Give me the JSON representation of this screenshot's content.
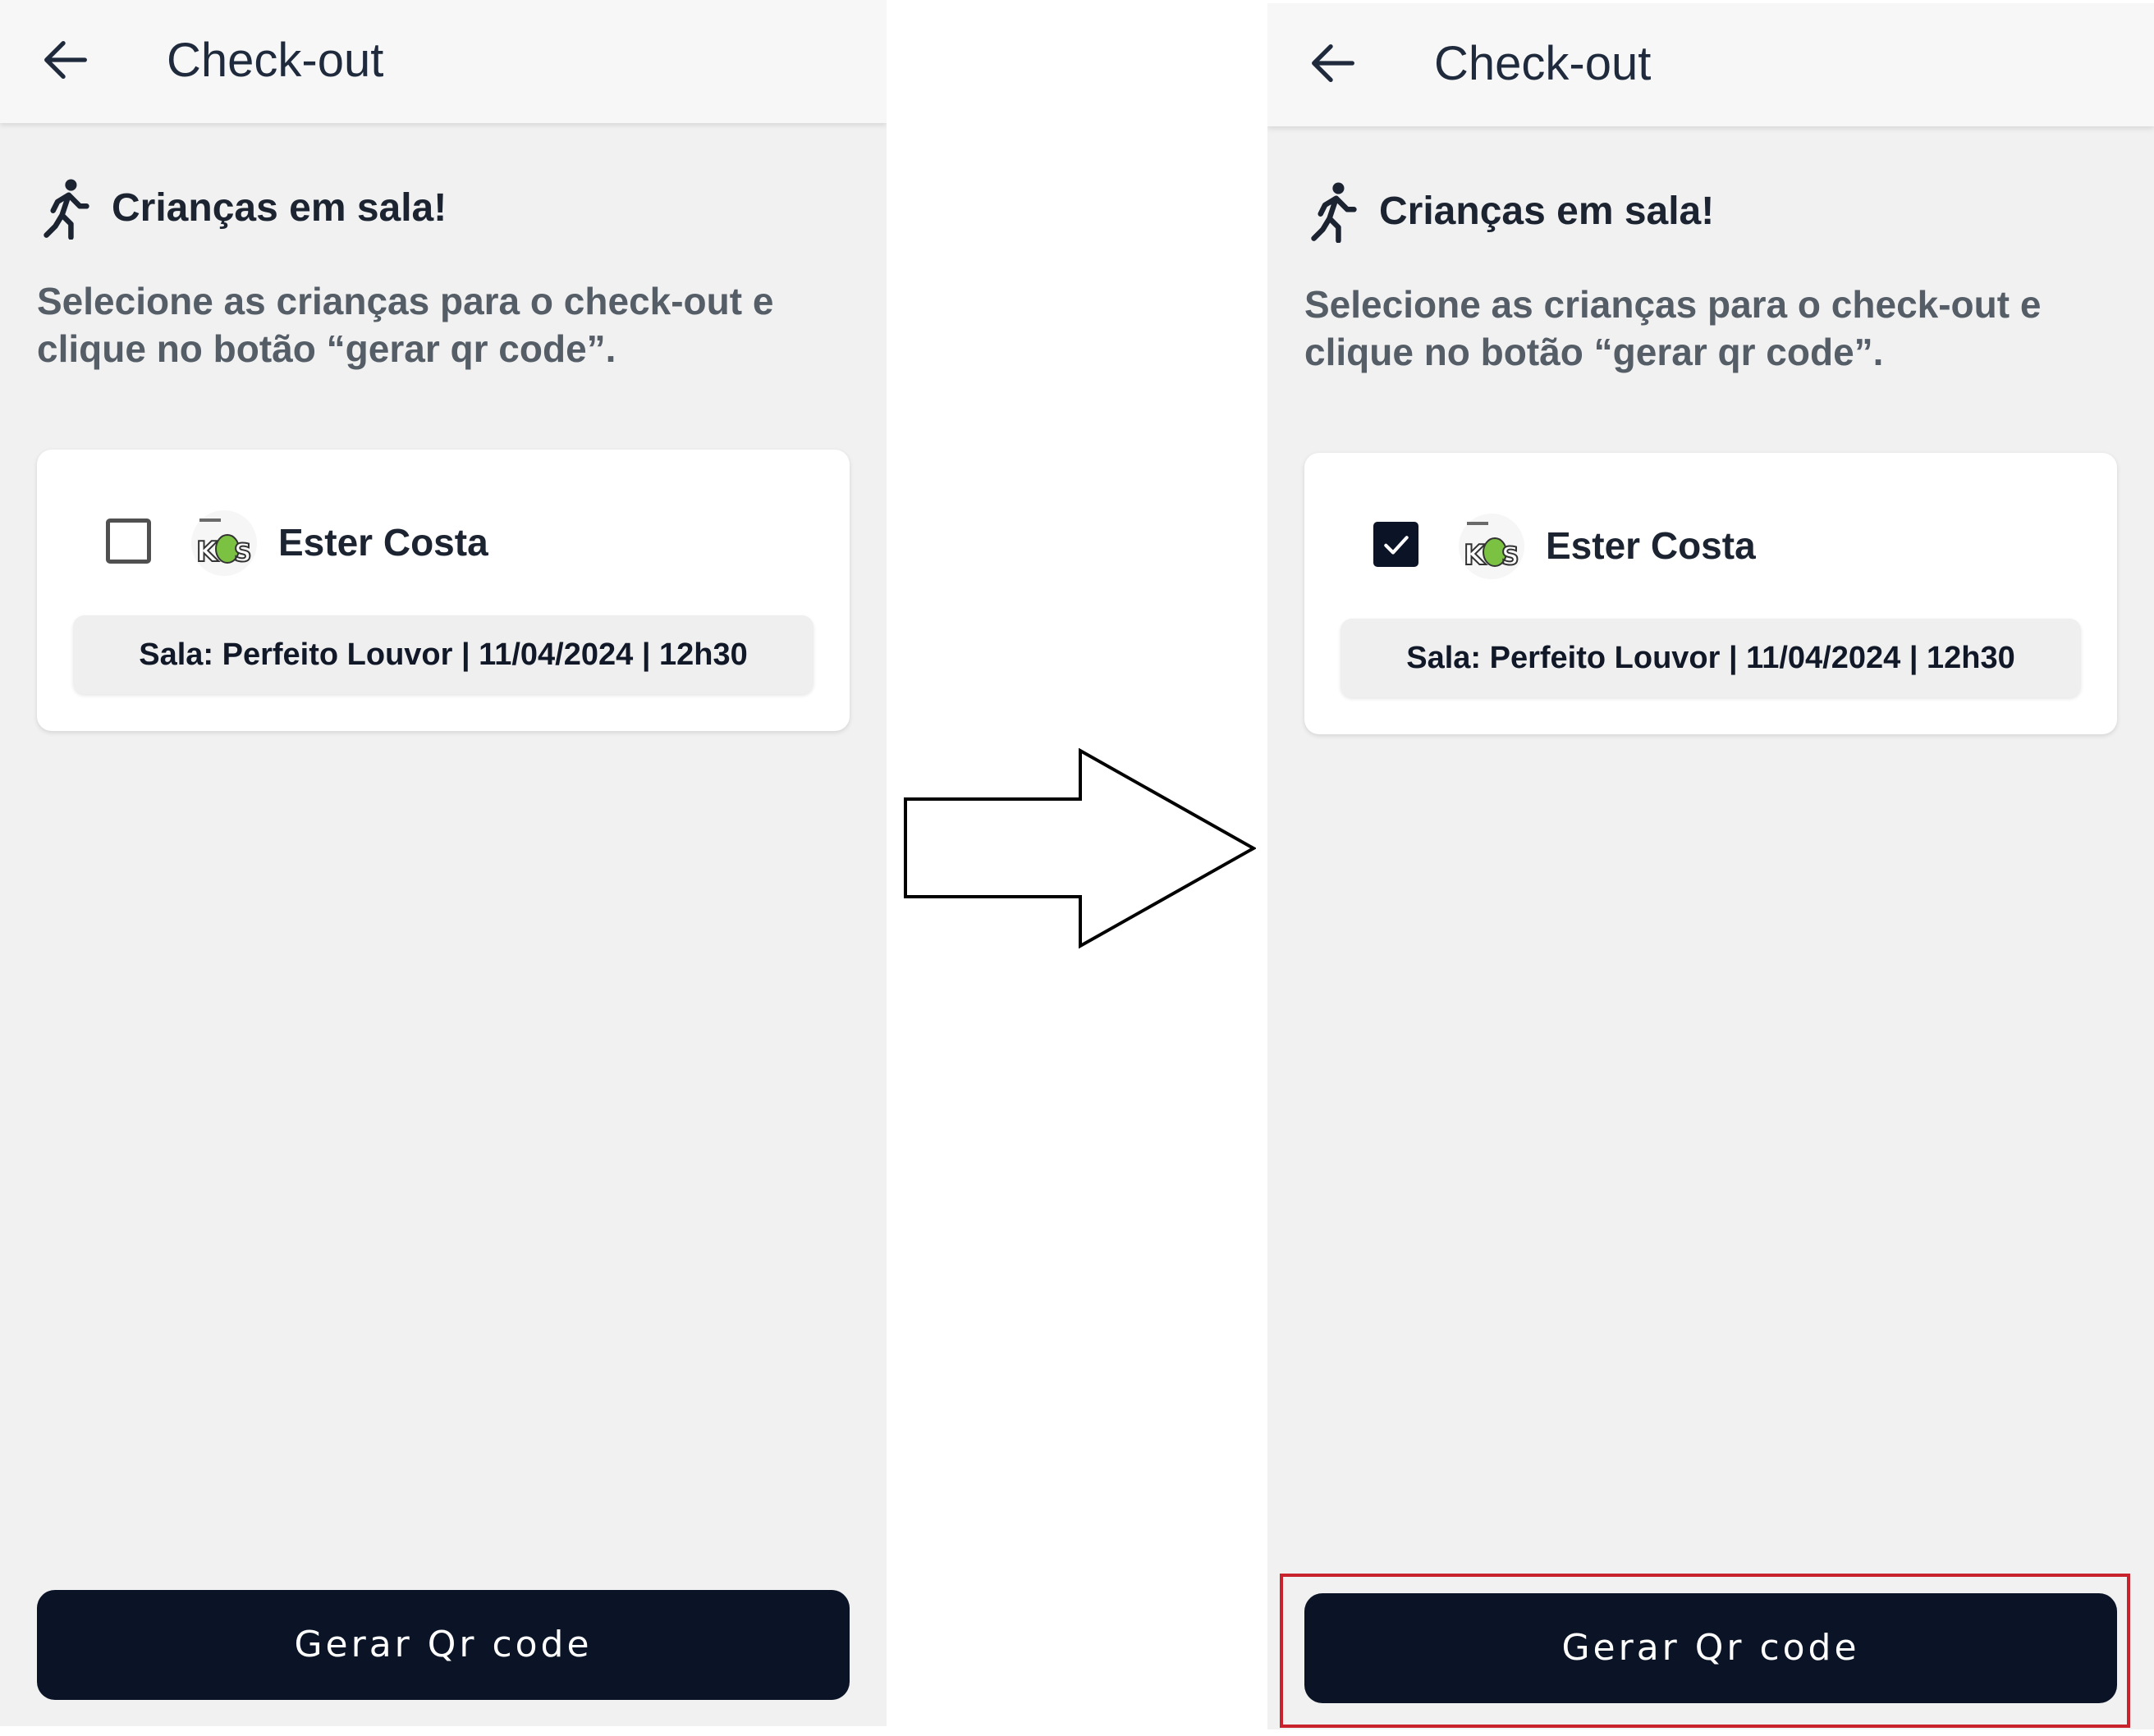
{
  "screens": {
    "before": {
      "title": "Check-out",
      "heading": "Crianças em sala!",
      "instructions": "Selecione as crianças para o check-out e clique no botão “gerar qr code”.",
      "child": {
        "name": "Ester Costa",
        "checked": false,
        "room_info": "Sala: Perfeito Louvor | 11/04/2024 | 12h30",
        "avatar_icon": "kids-logo-icon"
      },
      "button_label": "Gerar Qr code"
    },
    "after": {
      "title": "Check-out",
      "heading": "Crianças em sala!",
      "instructions": "Selecione as crianças para o check-out e clique no botão “gerar qr code”.",
      "child": {
        "name": "Ester Costa",
        "checked": true,
        "room_info": "Sala: Perfeito Louvor | 11/04/2024 | 12h30",
        "avatar_icon": "kids-logo-icon"
      },
      "button_label": "Gerar Qr code"
    }
  },
  "icons": {
    "back": "arrow-left-icon",
    "heading": "walking-person-icon",
    "transition": "right-arrow-icon",
    "check": "checkmark-icon"
  },
  "colors": {
    "primary_dark": "#0b1427",
    "screen_background": "#f1f1f1",
    "highlight": "#c8222c",
    "logo_green": "#7cc242"
  }
}
